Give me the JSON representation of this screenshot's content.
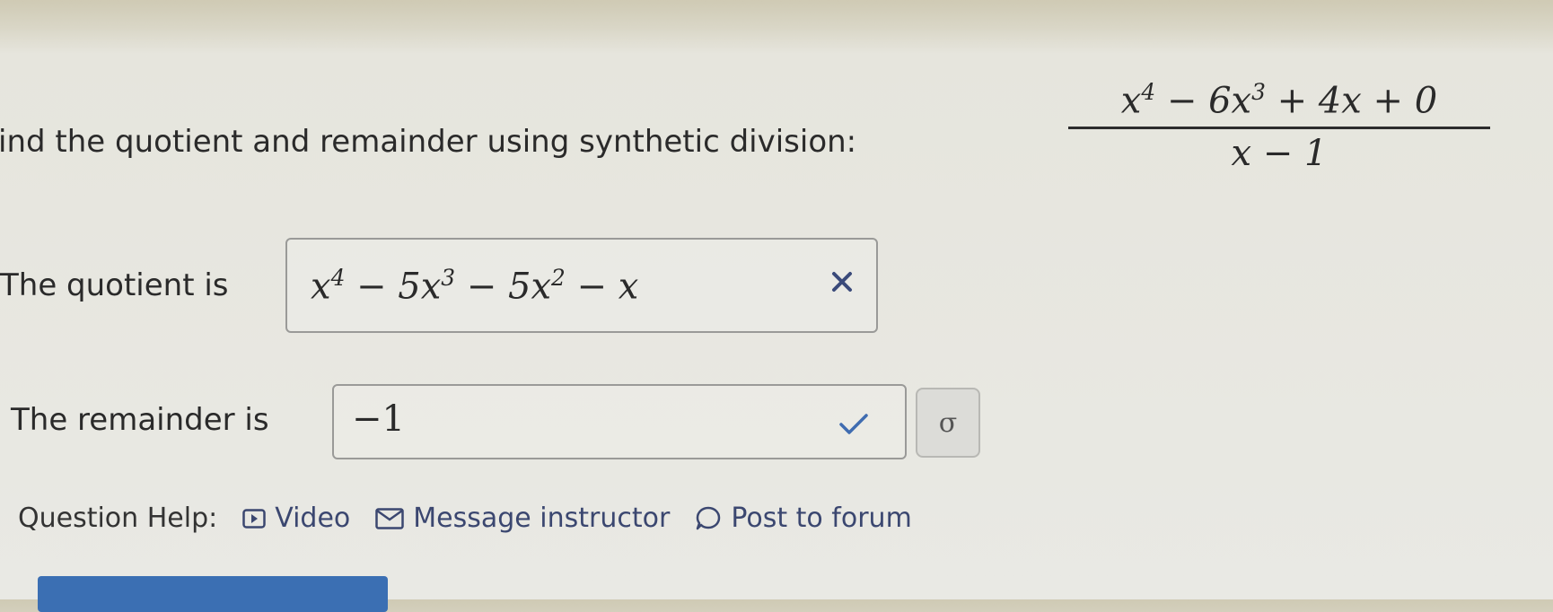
{
  "question": {
    "prompt": "ind the quotient and remainder using synthetic division:",
    "numerator": "x⁴ − 6x³ + 4x + 0",
    "denominator": "x − 1"
  },
  "quotient": {
    "label": "The quotient is",
    "value": "x⁴ − 5x³ − 5x² − x",
    "status": "incorrect"
  },
  "remainder": {
    "label": "The remainder is",
    "value": "−1",
    "status": "correct"
  },
  "sigma_button": {
    "label": "σ"
  },
  "help": {
    "label": "Question Help:",
    "video": "Video",
    "message": "Message instructor",
    "forum": "Post to forum"
  },
  "colors": {
    "incorrect": "#3a4a7a",
    "correct": "#3f6cb0",
    "link": "#3b4770",
    "submit": "#3b6fb3"
  }
}
